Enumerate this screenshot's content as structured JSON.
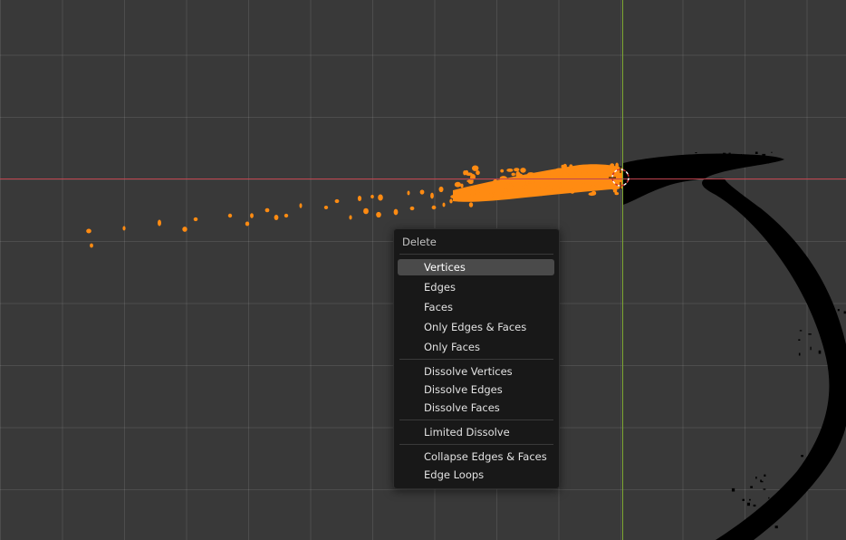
{
  "viewport": {
    "colors": {
      "background": "#393939",
      "x_axis": "#c0444f",
      "y_axis": "#7ea832",
      "selected": "#ff8b12",
      "unselected_mesh": "#000000"
    }
  },
  "delete_menu": {
    "title": "Delete",
    "groups": [
      [
        {
          "label": "Vertices",
          "active": true
        },
        {
          "label": "Edges"
        },
        {
          "label": "Faces"
        },
        {
          "label": "Only Edges & Faces"
        },
        {
          "label": "Only Faces"
        }
      ],
      [
        {
          "label": "Dissolve Vertices"
        },
        {
          "label": "Dissolve Edges"
        },
        {
          "label": "Dissolve Faces"
        }
      ],
      [
        {
          "label": "Limited Dissolve"
        }
      ],
      [
        {
          "label": "Collapse Edges & Faces"
        },
        {
          "label": "Edge Loops"
        }
      ]
    ]
  }
}
